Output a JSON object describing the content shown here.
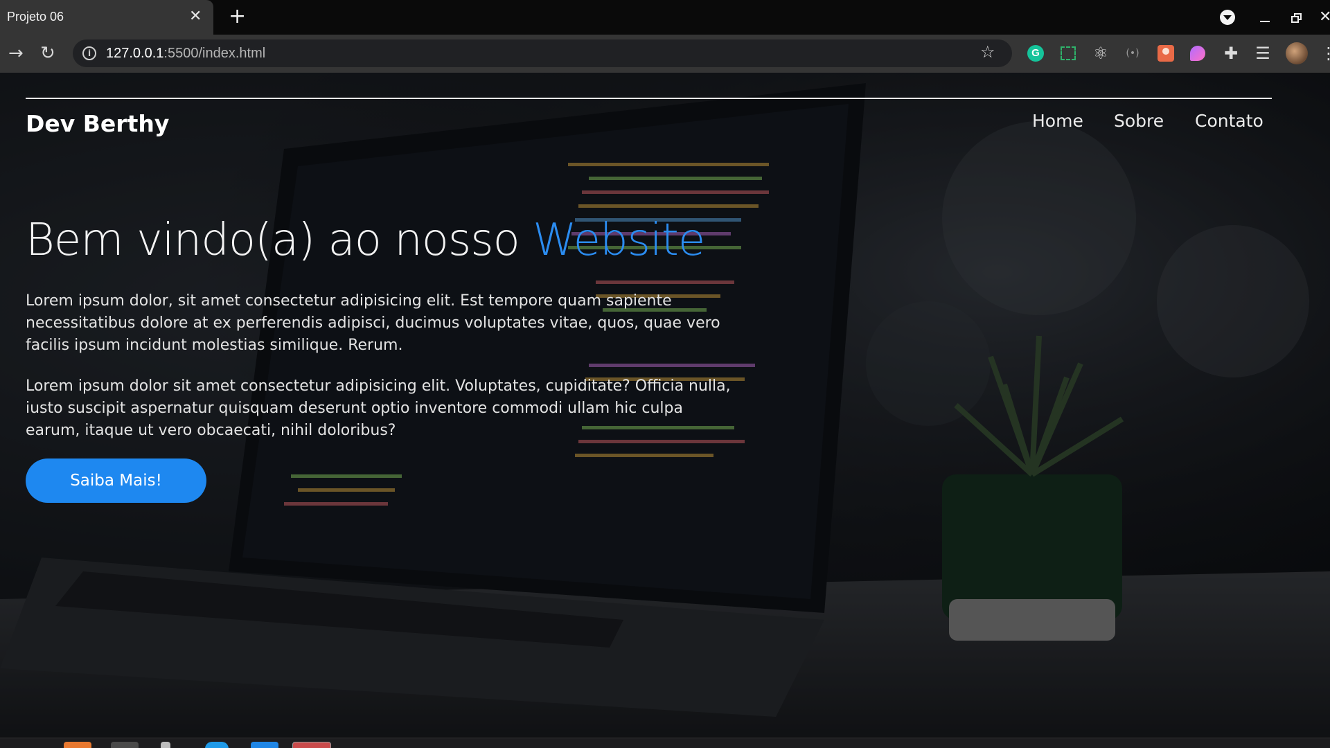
{
  "browser": {
    "tab_title": "Projeto 06",
    "tab_close_glyph": "✕",
    "new_tab_glyph": "+",
    "url_host": "127.0.0.1",
    "url_path": ":5500/index.html",
    "icons": [
      "back-arrow-icon",
      "reload-icon",
      "info-icon",
      "bookmark-star-icon",
      "grammarly-icon",
      "screenshot-icon",
      "atom-icon",
      "cast-icon",
      "avatar-extension-icon",
      "purple-extension-icon",
      "extensions-puzzle-icon",
      "reading-list-icon",
      "profile-avatar-icon",
      "menu-dots-icon",
      "minimize-icon",
      "restore-icon",
      "close-icon"
    ]
  },
  "page": {
    "logo": "Dev Berthy",
    "nav": [
      "Home",
      "Sobre",
      "Contato"
    ],
    "hero_title_prefix": "Bem vindo(a) ao nosso ",
    "hero_title_accent": "Website",
    "paragraphs": [
      "Lorem ipsum dolor, sit amet consectetur adipisicing elit. Est tempore quam sapiente necessitatibus dolore at ex perferendis adipisci, ducimus voluptates vitae, quos, quae vero facilis ipsum incidunt molestias similique. Rerum.",
      "Lorem ipsum dolor sit amet consectetur adipisicing elit. Voluptates, cupiditate? Officia nulla, iusto suscipit aspernatur quisquam deserunt optio inventore commodi ullam hic culpa earum, itaque ut vero obcaecati, nihil doloribus?"
    ],
    "cta_label": "Saiba Mais!"
  },
  "colors": {
    "accent": "#2b8cf0",
    "button": "#1e88f0",
    "tab_bg": "#353535",
    "chrome_bg": "#0a0a0a"
  }
}
